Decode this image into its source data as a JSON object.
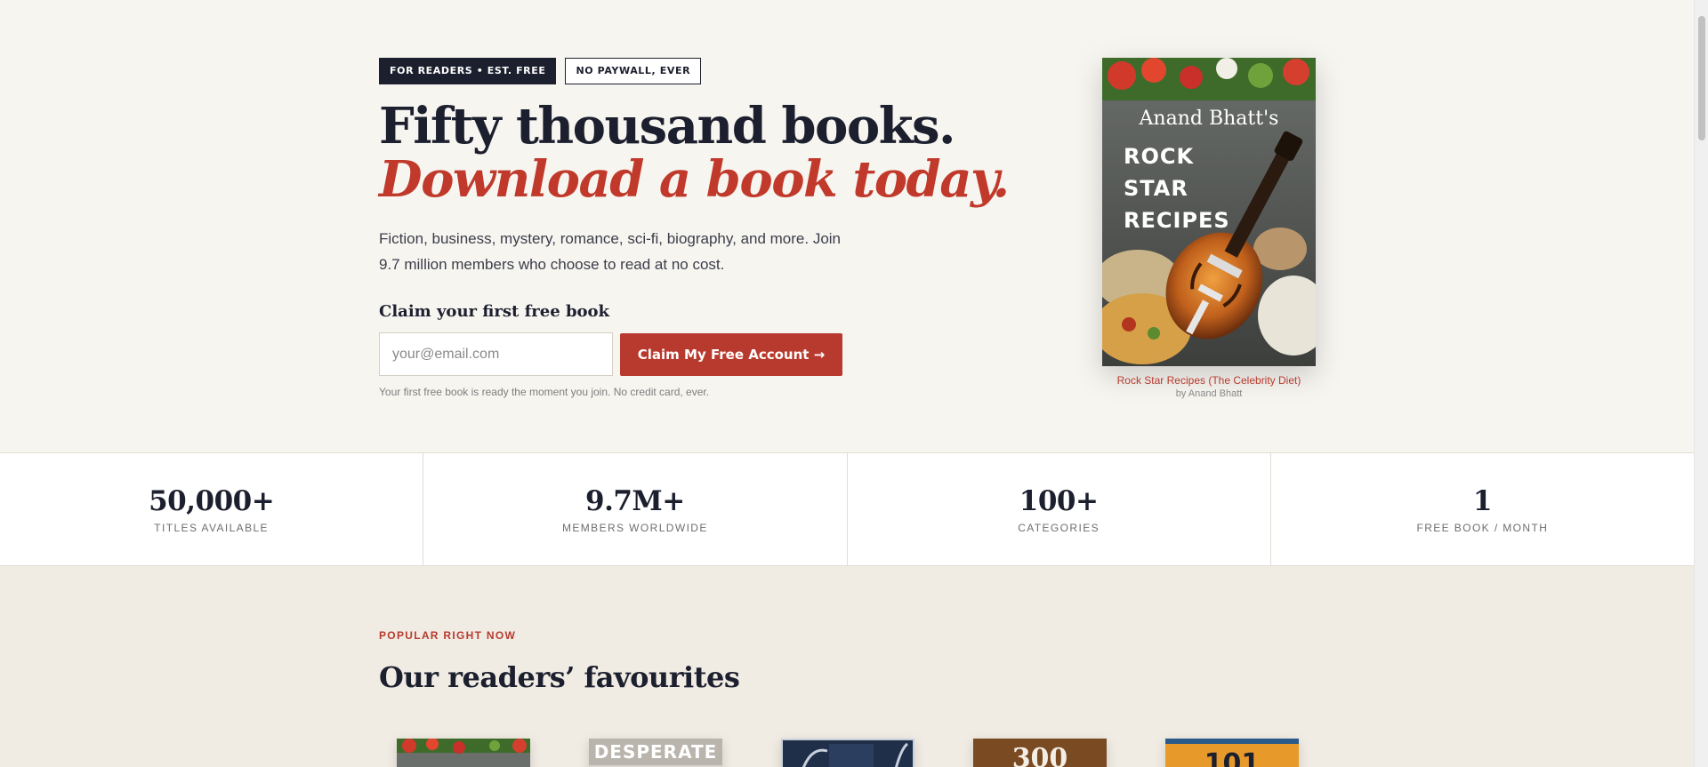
{
  "hero": {
    "badges": [
      "FOR READERS • EST. FREE",
      "NO PAYWALL, EVER"
    ],
    "headline_line1": "Fifty thousand books.",
    "headline_line2": "Download a book today.",
    "lead": "Fiction, business, mystery, romance, sci-fi, biography, and more. Join 9.7 million members who choose to read at no cost.",
    "claim_title": "Claim your first free book",
    "email_placeholder": "your@email.com",
    "claim_button": "Claim My Free Account →",
    "fineprint": "Your first free book is ready the moment you join. No credit card, ever."
  },
  "featured_book": {
    "cover_author_text": "Anand Bhatt's",
    "cover_title_text": "ROCK STAR RECIPES",
    "title": "Rock Star Recipes (The Celebrity Diet)",
    "author": "by Anand Bhatt"
  },
  "stats": [
    {
      "value": "50,000+",
      "label": "TITLES AVAILABLE"
    },
    {
      "value": "9.7M+",
      "label": "MEMBERS WORLDWIDE"
    },
    {
      "value": "100+",
      "label": "CATEGORIES"
    },
    {
      "value": "1",
      "label": "FREE BOOK / MONTH"
    }
  ],
  "popular": {
    "kicker": "POPULAR RIGHT NOW",
    "title": "Our readers’ favourites",
    "books": [
      {
        "cover_text": ""
      },
      {
        "cover_text": "DESPERATE"
      },
      {
        "cover_text": ""
      },
      {
        "cover_text": "300"
      },
      {
        "cover_text": "101"
      }
    ]
  },
  "colors": {
    "accent": "#b83a2e",
    "navy": "#1c1f2e",
    "hero_bg": "#f7f5f0",
    "section_bg": "#f0ece4"
  }
}
